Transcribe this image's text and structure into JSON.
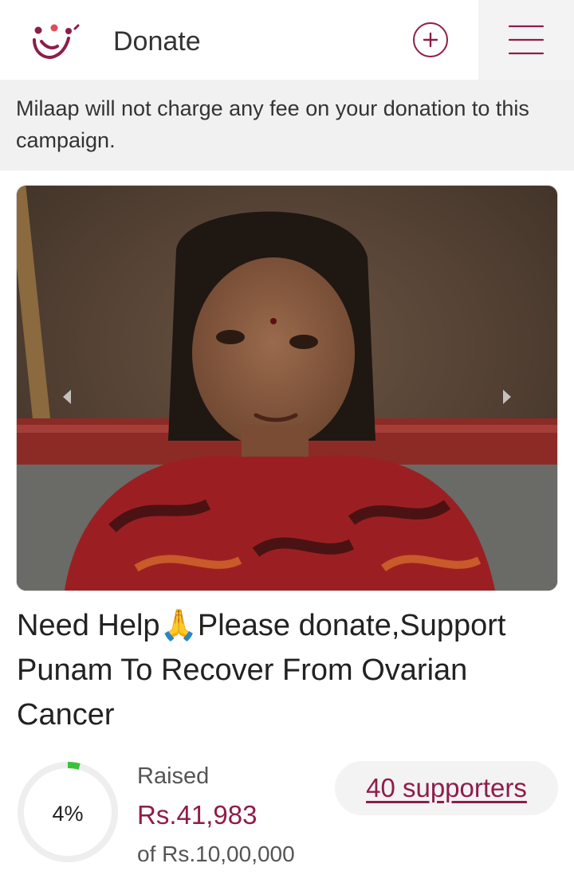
{
  "header": {
    "title": "Donate",
    "brand_color": "#8e1d4a"
  },
  "notice": {
    "text": "Milaap will not charge any fee on your donation to this campaign."
  },
  "carousel": {
    "prev_icon": "chevron-left-icon",
    "next_icon": "chevron-right-icon"
  },
  "campaign": {
    "title": "Need Help🙏Please donate,Support Punam To Recover From Ovarian Cancer"
  },
  "fundraising": {
    "percent_label": "4%",
    "progress_fraction": 0.04,
    "raised_label": "Raised",
    "raised_amount": "Rs.41,983",
    "goal_text": "of Rs.10,00,000",
    "supporters_link": "40 supporters",
    "progress_color": "#3cc13b",
    "track_color": "#eeeeee"
  }
}
